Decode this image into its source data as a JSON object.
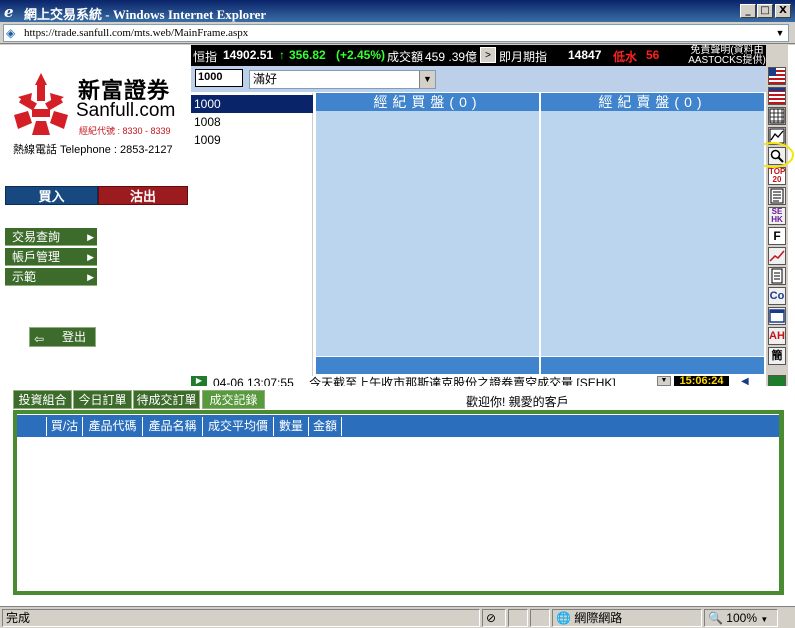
{
  "window": {
    "title": "網上交易系統 - Windows Internet Explorer",
    "minimize": "_",
    "maximize": "□",
    "close": "X"
  },
  "address": {
    "url": "https://trade.sanfull.com/mts.web/MainFrame.aspx"
  },
  "ticker": {
    "hsi_label": "恒指",
    "hsi_value": "14902.51",
    "hsi_change": "356.82",
    "hsi_pct": "(+2.45%)",
    "turnover_label": "成交額",
    "turnover_value": "459 .39億",
    "next_btn": ">",
    "futures_label": "即月期指",
    "futures_value": "14847",
    "discount_label": "低水",
    "discount_value": "56",
    "disclaimer_line1": "免責聲明(資料由",
    "disclaimer_line2": "AASTOCKS提供)"
  },
  "brand": {
    "name_cn": "新富證券",
    "name_en": "Sanfull.com",
    "broker_code": "經紀代號 : 8330 - 8339",
    "hotline": "熱線電話 Telephone : 2853-2127"
  },
  "trade_buttons": {
    "buy": "買入",
    "sell": "沽出"
  },
  "menu": [
    {
      "label": "交易查詢"
    },
    {
      "label": "帳戶管理"
    },
    {
      "label": "示範"
    }
  ],
  "logout": "登出",
  "stock_input": {
    "code": "1000",
    "selected_option": "滿好"
  },
  "stock_list": [
    "1000",
    "1008",
    "1009"
  ],
  "broker": {
    "buy_header": "經紀買盤(0)",
    "sell_header": "經紀賣盤(0)"
  },
  "news": {
    "text": "04-06 13:07:55 　今天截至上午收市那斯達克股份之證券賣空成交量 [SEHK]",
    "time": "15:06:24"
  },
  "tabs": [
    {
      "label": "投資組合"
    },
    {
      "label": "今日訂單"
    },
    {
      "label": "待成交訂單"
    },
    {
      "label": "成交記錄"
    }
  ],
  "welcome": "歡迎你! 親愛的客戶",
  "table": {
    "columns": [
      "買/沽",
      "產品代碼",
      "產品名稱",
      "成交平均價",
      "數量",
      "金額"
    ]
  },
  "icons": {
    "top20_label": "TOP 20",
    "sehk_label": "SE HK",
    "f_label": "F",
    "co_label": "Co",
    "ah_label": "AH",
    "jian_label": "簡"
  },
  "status": {
    "text": "完成",
    "zone": "網際網路",
    "zoom": "100%"
  }
}
